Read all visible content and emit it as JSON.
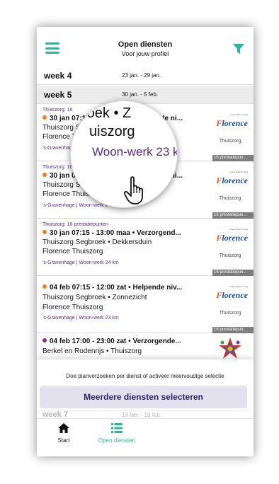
{
  "header": {
    "title": "Open diensten",
    "subtitle": "Voor jouw profiel"
  },
  "weeks": [
    {
      "label": "week 4",
      "range": "23 jan. - 29 jan."
    },
    {
      "label": "week 5",
      "range": "30 jan. - 5 feb."
    }
  ],
  "cards": [
    {
      "meta": "Thuiszorg: 16",
      "line1": "30 jan 07:15 - 13:00 maa • Helpende ni...",
      "line2": "Thuiszorg Segbroek • Dekkersduin",
      "line3": "Florence Thuiszorg",
      "foot": "'s-Gravenhage | Woon-werk 24 km",
      "org": "Thuiszorg",
      "points": "16 prestatiepun...",
      "dot_color": "#ef7d22",
      "logo": "florence"
    },
    {
      "meta": "Thuiszorg: 16 prestatiepunten",
      "line1": "30 jan 07:15 - 13:00 maa • Helpende ni...",
      "line2": "Thuiszorg Segbroek • Dekkersduin",
      "line3": "Florence Thuiszorg",
      "foot": "'s-Gravenhage | Woon-werk 24 km",
      "org": "Thuiszorg",
      "points": "16 prestatiepun...",
      "dot_color": "#ef7d22",
      "logo": "florence"
    },
    {
      "meta": "Thuiszorg: 16 prestatiepunten",
      "line1": "30 jan 07:15 - 13:00 maa • Verzorgend...",
      "line2": "Thuiszorg Segbroek • Dekkersduin",
      "line3": "Florence Thuiszorg",
      "foot": "'s-Gravenhage | Woon-werk 24 km",
      "org": "Thuiszorg",
      "points": "16 prestatiepun...",
      "dot_color": "#ef7d22",
      "logo": "florence"
    },
    {
      "meta": "",
      "line1": "04 feb 07:15 - 12:00 zat • Helpende niv...",
      "line2": "Thuiszorg Segbroek • Zonnezicht",
      "line3": "Florence Thuiszorg",
      "foot": "'s-Gravenhage | Woon-werk 23 km",
      "org": "Thuiszorg",
      "points": "16 prestatiepun...",
      "dot_color": "#ef7d22",
      "logo": "florence"
    },
    {
      "meta": "",
      "line1": "04 feb 17:00 - 23:00 zat • Verzorgende...",
      "line2": "Berkel en Rodenrijs • Thuiszorg",
      "line3": "",
      "foot": "",
      "org": "",
      "points": "",
      "dot_color": "#8b2a7e",
      "logo": "star"
    }
  ],
  "logo": {
    "small_text": "Goed afstel in Zorg",
    "florence_f": "F",
    "florence_rest": "lorence"
  },
  "magnifier": {
    "line1": "roek • Z",
    "line2": "uiszorg",
    "line3": "Woon-werk 23 km"
  },
  "card2_zoom_fragment": "Thuiszorg: 16",
  "sheet": {
    "hint": "Doe planverzoeken per dienst of activeer meervoudige selectie",
    "button_label": "Meerdere diensten selecteren"
  },
  "faded_week": {
    "label": "week 7",
    "range": "13 feb. - 19 feb."
  },
  "tabs": [
    {
      "label": "Start",
      "icon": "home-icon",
      "active": false
    },
    {
      "label": "Open diensten",
      "icon": "list-icon",
      "active": true
    }
  ],
  "colors": {
    "accent": "#2bb79a",
    "purple": "#5a2a86",
    "orange": "#ef7d22"
  }
}
